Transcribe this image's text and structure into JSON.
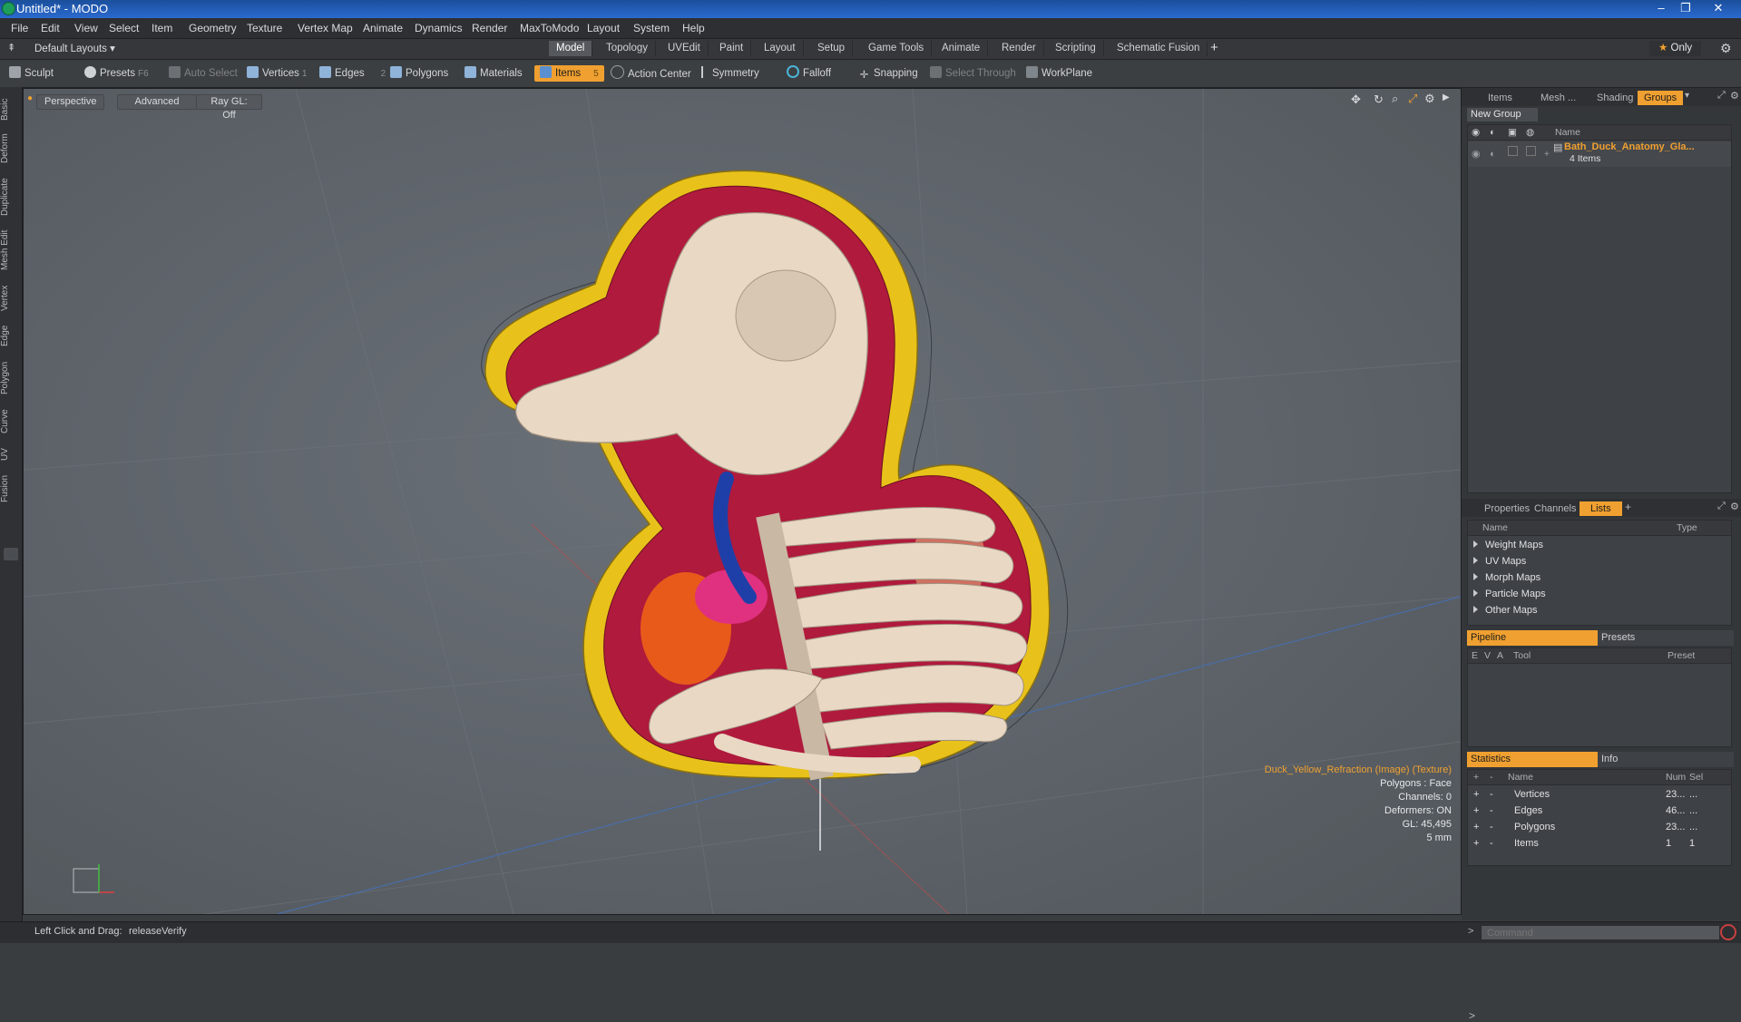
{
  "window": {
    "title": "Untitled* - MODO"
  },
  "menu": [
    "File",
    "Edit",
    "View",
    "Select",
    "Item",
    "Geometry",
    "Texture",
    "Vertex Map",
    "Animate",
    "Dynamics",
    "Render",
    "MaxToModo",
    "Layout",
    "System",
    "Help"
  ],
  "layout_dropdown": "Default Layouts",
  "layout_tabs": [
    "Model",
    "Topology",
    "UVEdit",
    "Paint",
    "Layout",
    "Setup",
    "Game Tools",
    "Animate",
    "Render",
    "Scripting",
    "Schematic Fusion"
  ],
  "layout_plus": "+",
  "only_label": "Only",
  "toolbar": {
    "sculpt": "Sculpt",
    "presets": "Presets",
    "presets_key": "F6",
    "auto_select": "Auto Select",
    "vertices": "Vertices",
    "vertices_key": "1",
    "edges": "Edges",
    "edges_key": "2",
    "polygons": "Polygons",
    "materials": "Materials",
    "items": "Items",
    "items_key": "5",
    "action_center": "Action Center",
    "symmetry": "Symmetry",
    "falloff": "Falloff",
    "snapping": "Snapping",
    "select_through": "Select Through",
    "workplane": "WorkPlane"
  },
  "left_tabs": [
    "Basic",
    "Deform",
    "Duplicate",
    "Mesh Edit",
    "Vertex",
    "Edge",
    "Polygon",
    "Curve",
    "UV",
    "Fusion"
  ],
  "viewport": {
    "view_mode": "Perspective",
    "shading": "Advanced",
    "raygl": "Ray GL: Off",
    "info": {
      "texture": "Duck_Yellow_Refraction (Image) (Texture)",
      "polygons": "Polygons : Face",
      "channels": "Channels: 0",
      "deformers": "Deformers: ON",
      "gl": "GL: 45,495",
      "scale": "5 mm"
    }
  },
  "top_panel": {
    "tabs": [
      "Items",
      "Mesh ...",
      "Shading",
      "Groups"
    ],
    "new_group": "New Group",
    "name_header": "Name",
    "group_name": "Bath_Duck_Anatomy_Gla...",
    "group_count": "4 Items"
  },
  "mid_panel": {
    "tabs": [
      "Properties",
      "Channels",
      "Lists"
    ],
    "plus": "+",
    "headers": {
      "name": "Name",
      "type": "Type"
    },
    "items": [
      "Weight Maps",
      "UV Maps",
      "Morph Maps",
      "Particle Maps",
      "Other Maps"
    ]
  },
  "pipeline": {
    "tabs": [
      "Pipeline",
      "Presets"
    ],
    "headers": {
      "e": "E",
      "v": "V",
      "a": "A",
      "tool": "Tool",
      "preset": "Preset"
    }
  },
  "statistics": {
    "tabs": [
      "Statistics",
      "Info"
    ],
    "headers": {
      "plus": "+",
      "minus": "-",
      "name": "Name",
      "num": "Num",
      "sel": "Sel"
    },
    "rows": [
      {
        "name": "Vertices",
        "num": "23...",
        "sel": "..."
      },
      {
        "name": "Edges",
        "num": "46...",
        "sel": "..."
      },
      {
        "name": "Polygons",
        "num": "23...",
        "sel": "..."
      },
      {
        "name": "Items",
        "num": "1",
        "sel": "1"
      }
    ]
  },
  "command": {
    "placeholder": "Command"
  },
  "status": {
    "hint_label": "Left Click and Drag:",
    "hint_value": "releaseVerify"
  },
  "colors": {
    "accent": "#f0a030",
    "title_bar": "#2a6ad0",
    "duck_yellow": "#e8c21a",
    "duck_inner": "#b01a3c",
    "bone": "#e8d8c4"
  }
}
